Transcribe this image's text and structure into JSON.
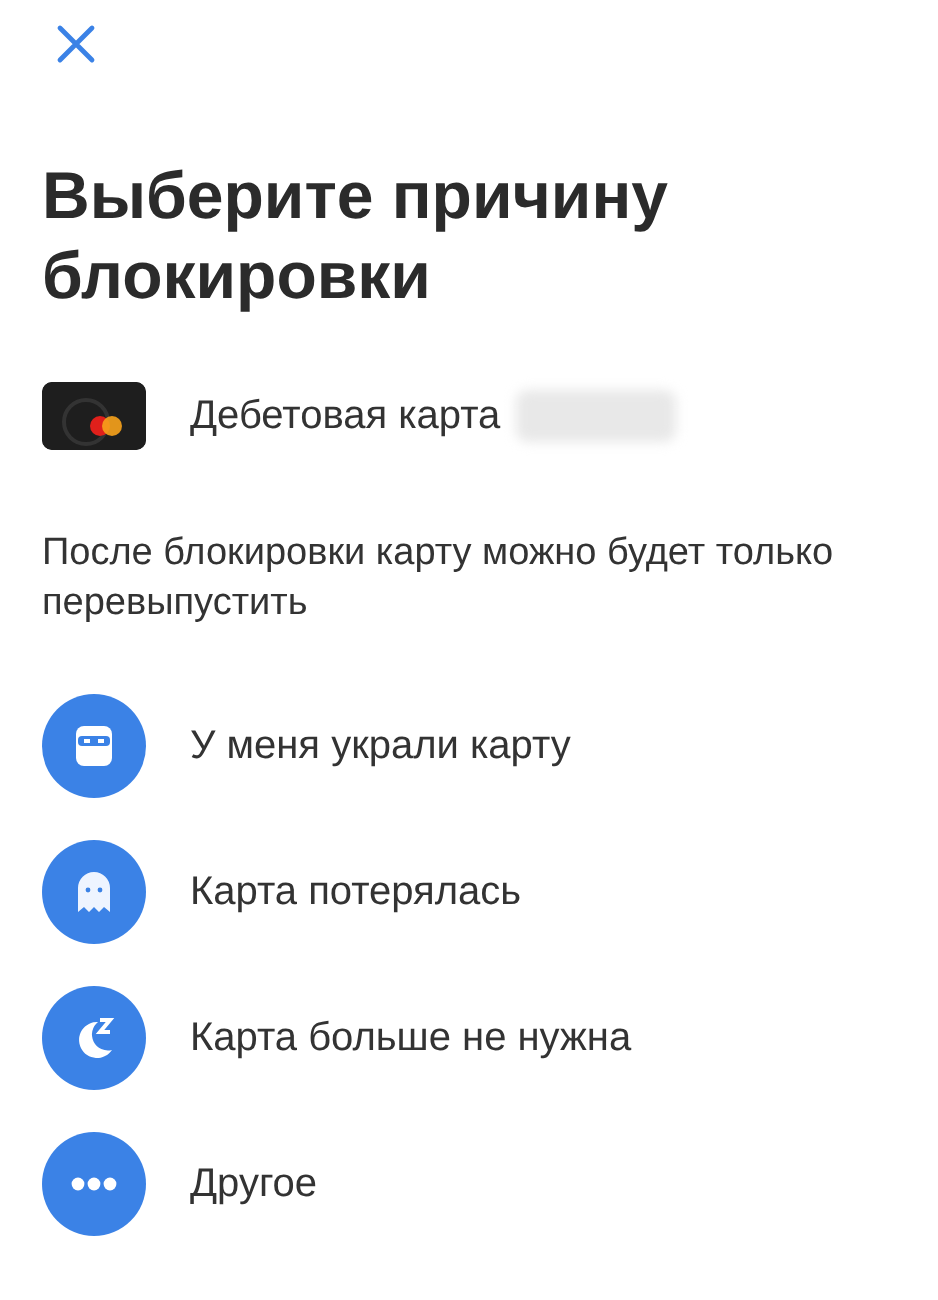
{
  "title": "Выберите причину блокировки",
  "card": {
    "label": "Дебетовая карта"
  },
  "note": "После блокировки карту можно будет только перевыпустить",
  "reasons": [
    {
      "label": "У меня украли карту"
    },
    {
      "label": "Карта потерялась"
    },
    {
      "label": "Карта больше не нужна"
    },
    {
      "label": "Другое"
    }
  ]
}
